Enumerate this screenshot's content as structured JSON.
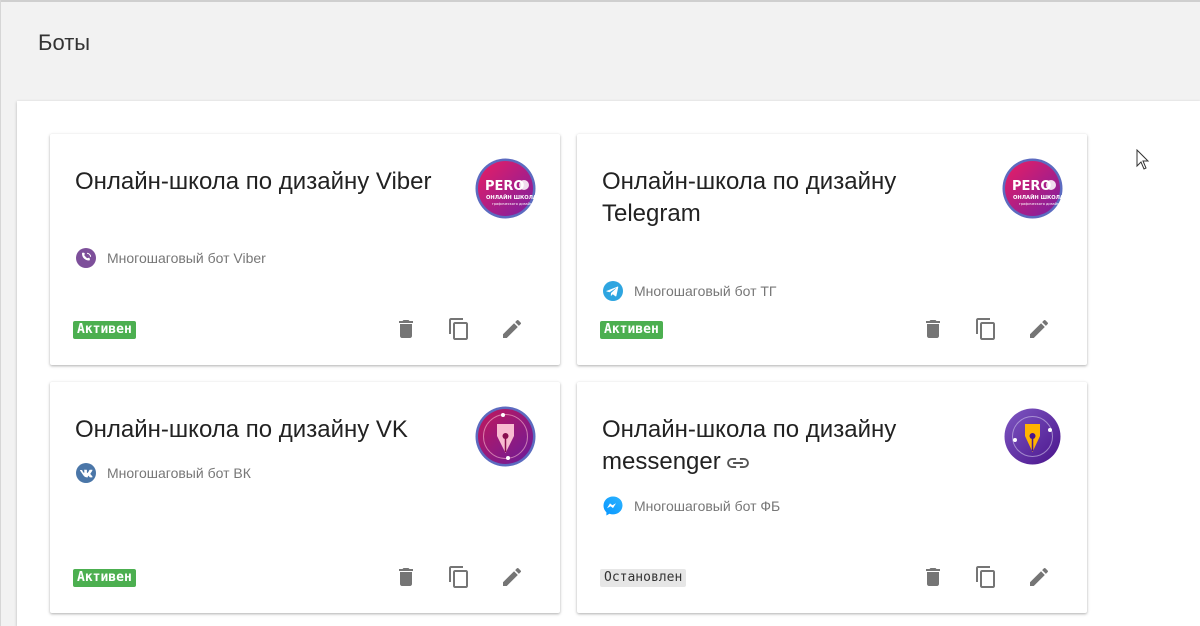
{
  "page": {
    "title": "Боты"
  },
  "bots": [
    {
      "title": "Онлайн-школа по дизайну Viber",
      "subtitle": "Многошаговый бот Viber",
      "platform_icon": "viber-icon",
      "status": "Активен",
      "status_type": "active",
      "avatar": "pero-logo",
      "avatar_text_main": "PERO",
      "avatar_text_sub": "ОНЛАЙН ШКОЛА",
      "avatar_text_small": "графического дизайна"
    },
    {
      "title": "Онлайн-школа по дизайну Telegram",
      "subtitle": "Многошаговый бот ТГ",
      "platform_icon": "telegram-icon",
      "status": "Активен",
      "status_type": "active",
      "avatar": "pero-logo",
      "avatar_text_main": "PERO",
      "avatar_text_sub": "ОНЛАЙН ШКОЛА",
      "avatar_text_small": "графического дизайна"
    },
    {
      "title": "Онлайн-школа по дизайну VK",
      "subtitle": "Многошаговый бот ВК",
      "platform_icon": "vk-icon",
      "status": "Активен",
      "status_type": "active",
      "avatar": "pen-nib-logo-pink"
    },
    {
      "title": "Онлайн-школа по дизайну messenger",
      "subtitle": "Многошаговый бот ФБ",
      "platform_icon": "messenger-icon",
      "status": "Остановлен",
      "status_type": "stopped",
      "avatar": "pen-nib-logo-purple",
      "has_link_icon": true
    }
  ],
  "colors": {
    "active": "#4caf50",
    "stopped_bg": "#e6e6e6",
    "viber": "#7d4f9a",
    "telegram": "#2ea5e0",
    "vk": "#4a76a8",
    "messenger": "#0a7cff",
    "icon_gray": "#757575"
  }
}
